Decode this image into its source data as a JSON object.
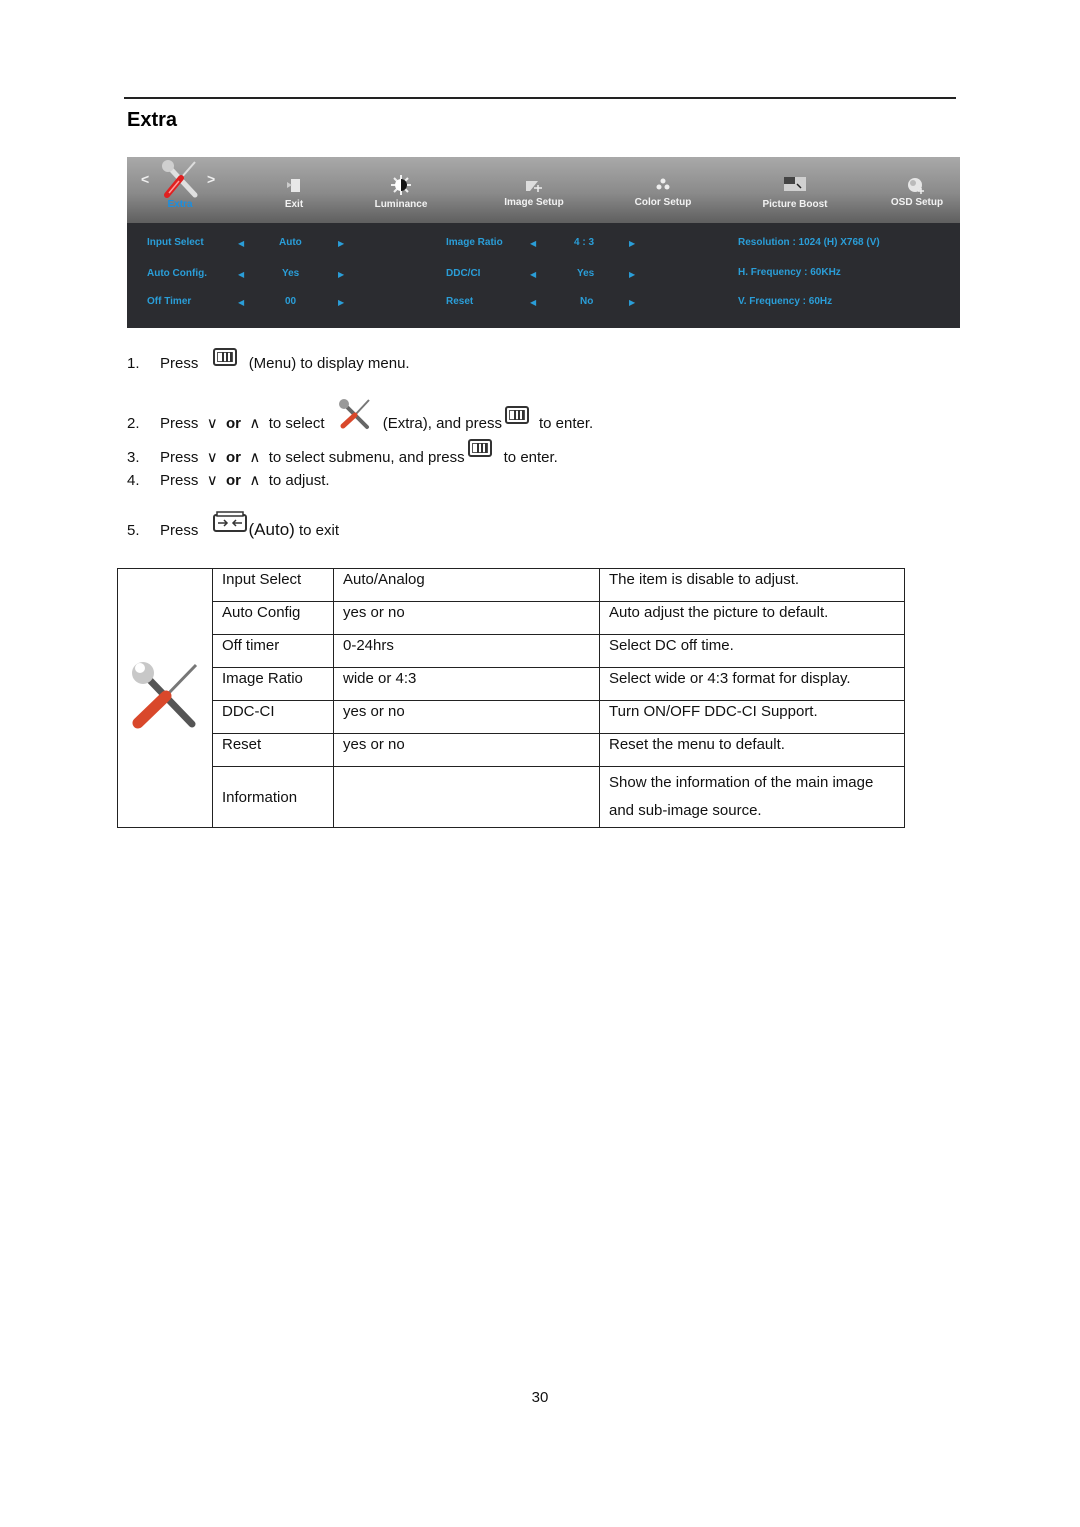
{
  "section": {
    "title": "Extra"
  },
  "osd": {
    "tabs": [
      {
        "label": "Extra",
        "icon": "tools-icon",
        "active": true
      },
      {
        "label": "Exit",
        "icon": "exit-icon",
        "active": false
      },
      {
        "label": "Luminance",
        "icon": "brightness-icon",
        "active": false
      },
      {
        "label": "Image Setup",
        "icon": "image-setup-icon",
        "active": false
      },
      {
        "label": "Color Setup",
        "icon": "color-dots-icon",
        "active": false
      },
      {
        "label": "Picture Boost",
        "icon": "picture-boost-icon",
        "active": false
      },
      {
        "label": "OSD Setup",
        "icon": "osd-setup-icon",
        "active": false
      }
    ],
    "nav_prev": "<",
    "nav_next": ">",
    "settings_left": [
      {
        "label": "Input Select",
        "value": "Auto"
      },
      {
        "label": "Auto Config.",
        "value": "Yes"
      },
      {
        "label": "Off Timer",
        "value": "00"
      }
    ],
    "settings_middle": [
      {
        "label": "Image Ratio",
        "value": "4 : 3"
      },
      {
        "label": "DDC/CI",
        "value": "Yes"
      },
      {
        "label": "Reset",
        "value": "No"
      }
    ],
    "info": [
      "Resolution : 1024 (H) X768 (V)",
      "H. Frequency : 60KHz",
      "V. Frequency : 60Hz"
    ],
    "arrow_left": "◀",
    "arrow_right": "▶",
    "colors": {
      "accent": "#2a9ed8",
      "active_tab": "#1a8fe0",
      "body_bg": "#2b2c30"
    }
  },
  "steps": [
    {
      "num": "1.",
      "press": "Press",
      "text_after": "(Menu) to display menu."
    },
    {
      "num": "2.",
      "press": "Press",
      "down": "∨",
      "or": "or",
      "up": "∧",
      "select": "to select",
      "extra": "(Extra), and press",
      "enter": "to enter."
    },
    {
      "num": "3.",
      "press": "Press",
      "down": "∨",
      "or": "or",
      "up": "∧",
      "select": "to select submenu, and press",
      "enter": "to enter."
    },
    {
      "num": "4.",
      "press": "Press",
      "down": "∨",
      "or": "or",
      "up": "∧",
      "adjust": "to adjust."
    },
    {
      "num": "5.",
      "press": "Press",
      "auto": "(Auto)",
      "exit": "to exit"
    }
  ],
  "table": {
    "rows": [
      {
        "item": "Input Select",
        "range": "Auto/Analog",
        "desc": "The item is disable to adjust."
      },
      {
        "item": "Auto Config",
        "range": "yes or no",
        "desc": "Auto adjust the picture to default."
      },
      {
        "item": "Off timer",
        "range": "0-24hrs",
        "desc": "Select DC off time."
      },
      {
        "item": "Image Ratio",
        "range": "wide or 4:3",
        "desc": "Select wide or 4:3 format for display."
      },
      {
        "item": "DDC-CI",
        "range": "yes or no",
        "desc": "Turn ON/OFF DDC-CI Support."
      },
      {
        "item": "Reset",
        "range": "yes or no",
        "desc": "Reset the menu to default."
      },
      {
        "item": "Information",
        "range": "",
        "desc": "Show the information of the main image and sub-image source."
      }
    ]
  },
  "page_number": "30"
}
